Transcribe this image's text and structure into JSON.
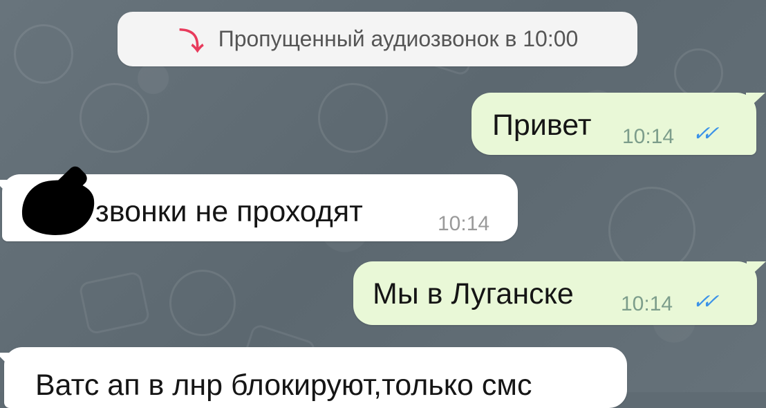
{
  "system_message": {
    "icon": "missed-call-icon",
    "text": "Пропущенный аудиозвонок в 10:00"
  },
  "messages": [
    {
      "direction": "outgoing",
      "text": "Привет",
      "time": "10:14",
      "status_icon": "double-check-icon",
      "status_mark": "✓✓"
    },
    {
      "direction": "incoming",
      "text": "звонки не проходят",
      "time": "10:14",
      "redacted": true
    },
    {
      "direction": "outgoing",
      "text": "Мы в Луганске",
      "time": "10:14",
      "status_icon": "double-check-icon",
      "status_mark": "✓✓"
    },
    {
      "direction": "incoming",
      "text": "Ватс ап в лнр блокируют,только смс"
    }
  ],
  "colors": {
    "background": "#5f6b73",
    "outgoing_bubble": "#e9f8d7",
    "incoming_bubble": "#ffffff",
    "missed_call": "#e83b5c",
    "read_status": "#3b92e8"
  }
}
